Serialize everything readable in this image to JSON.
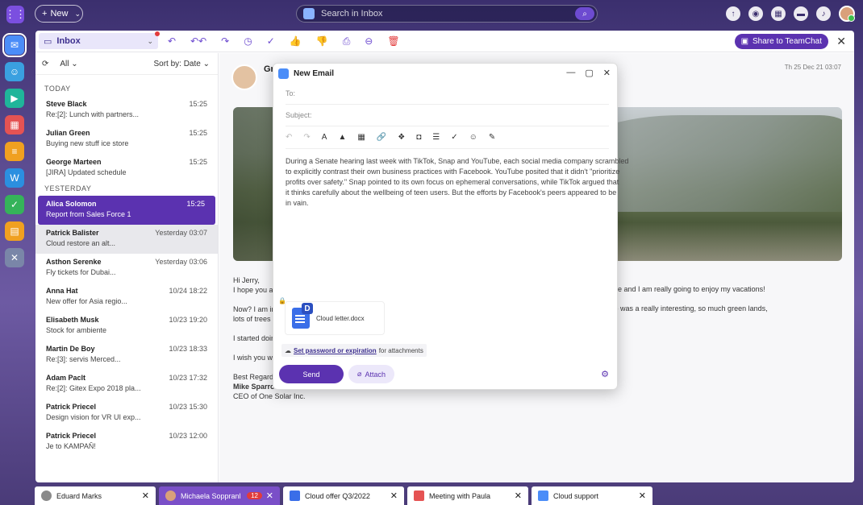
{
  "topbar": {
    "new_label": "New",
    "search_placeholder": "Search in Inbox"
  },
  "toolbar": {
    "folder": "Inbox",
    "share_label": "Share to TeamChat"
  },
  "list": {
    "filter": "All",
    "sort": "Sort by: Date",
    "sections": [
      {
        "title": "TODAY",
        "items": [
          {
            "from": "Steve Black",
            "subject": "Re:[2]: Lunch with partners...",
            "time": "15:25"
          },
          {
            "from": "Julian Green",
            "subject": "Buying new stuff ice store",
            "time": "15:25"
          },
          {
            "from": "George Marteen",
            "subject": "[JIRA] Updated schedule",
            "time": "15:25"
          }
        ]
      },
      {
        "title": "YESTERDAY",
        "items": [
          {
            "from": "Alica Solomon",
            "subject": "Report from Sales Force 1",
            "time": "15:25"
          },
          {
            "from": "Patrick Balister",
            "subject": "Cloud restore an alt...",
            "time": "Yesterday 03:07"
          },
          {
            "from": "Asthon Serenke",
            "subject": "Fly tickets for Dubai...",
            "time": "Yesterday 03:06"
          },
          {
            "from": "Anna Hat",
            "subject": "New offer for Asia regio...",
            "time": "10/24 18:22"
          },
          {
            "from": "Elisabeth Musk",
            "subject": "Stock for ambiente",
            "time": "10/23 19:20"
          },
          {
            "from": "Martin De Boy",
            "subject": "Re:[3]: servis Merced...",
            "time": "10/23 18:33"
          },
          {
            "from": "Adam Paclt",
            "subject": "Re:[2]: Gitex Expo 2018 pla...",
            "time": "10/23 17:32"
          },
          {
            "from": "Patrick Priecel",
            "subject": "Design vision for VR UI exp...",
            "time": "10/23 15:30"
          },
          {
            "from": "Patrick Priecel",
            "subject": "Je to KAMPAŇ!",
            "time": "10/23 12:00"
          }
        ]
      }
    ]
  },
  "reader": {
    "sender_initial": "Gr",
    "date": "Th 25 Dec 21 03:07",
    "greeting": "Hi Jerry,",
    "line1": "I hope you ar",
    "line1_right": "time and I am really going to enjoy my vacations!",
    "line2": "Now? I am in",
    "line2_right": "trip was a really interesting, so much green lands,",
    "line2b": "lots of trees a",
    "line3": "I started doin",
    "line4": "I wish you we",
    "sign_regards": "Best Regards",
    "sign_name": "Mike Sparrov",
    "sign_title": "CEO of One Solar Inc."
  },
  "compose": {
    "title": "New Email",
    "to_placeholder": "To:",
    "subject_placeholder": "Subject:",
    "body_lines": [
      "During a Senate hearing last week with TikTok, Snap and YouTube, each social media company scrambled",
      "to explicitly contrast their own business practices with Facebook. YouTube posited that it didn't \"prioritize",
      "profits over safety.\" Snap pointed to its own focus on ephemeral conversations, while TikTok argued that",
      "it thinks carefully about the wellbeing of teen users. But the efforts by Facebook's peers appeared to be",
      "in vain."
    ],
    "attachment_name": "Cloud letter.docx",
    "attachment_badge": "D",
    "password_link": "Set password or expiration",
    "password_suffix": "for attachments",
    "send_label": "Send",
    "attach_label": "Attach"
  },
  "taskbar": [
    {
      "label": "Eduard Marks",
      "color": "#8a8a8a"
    },
    {
      "label": "Michaela Soppranl",
      "color": "#d9a07a",
      "count": "12"
    },
    {
      "label": "Cloud offer Q3/2022",
      "color": "#3a6ee8"
    },
    {
      "label": "Meeting with Paula",
      "color": "#e55353"
    },
    {
      "label": "Cloud support",
      "color": "#4b8df8"
    }
  ],
  "colors": {
    "accent": "#5b32b0",
    "danger": "#e23b3b"
  }
}
